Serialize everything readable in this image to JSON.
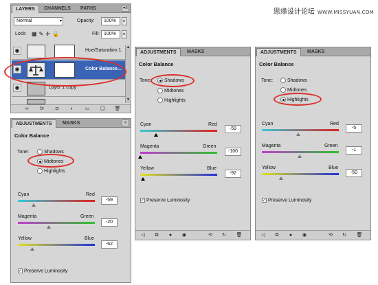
{
  "watermark": {
    "text": "思缘设计论坛",
    "site": "WWW.MISSYUAN.COM"
  },
  "layers_panel": {
    "tabs": [
      "LAYERS",
      "CHANNELS",
      "PATHS"
    ],
    "blend_mode": "Normal",
    "opacity_label": "Opacity:",
    "opacity_value": "100%",
    "lock_label": "Lock:",
    "fill_label": "Fill:",
    "fill_value": "100%",
    "layers": [
      {
        "name": "Hue/Saturation 1",
        "selected": false
      },
      {
        "name": "Color Balance...",
        "selected": true
      },
      {
        "name": "Layer 1 copy",
        "selected": false
      }
    ],
    "bottom_icons": [
      "link-icon",
      "fx-icon",
      "mask-icon",
      "adjustment-icon",
      "folder-icon",
      "new-layer-icon",
      "trash-icon"
    ]
  },
  "adjustments_panels": [
    {
      "tabs": [
        "ADJUSTMENTS",
        "MASKS"
      ],
      "title": "Color Balance",
      "tone_label": "Tone:",
      "tones": [
        "Shadows",
        "Midtones",
        "Highlights"
      ],
      "selected_tone": "Midtones",
      "sliders": [
        {
          "left": "Cyan",
          "right": "Red",
          "value": "-59",
          "level": -59
        },
        {
          "left": "Magenta",
          "right": "Green",
          "value": "-20",
          "level": -20
        },
        {
          "left": "Yellow",
          "right": "Blue",
          "value": "-62",
          "level": -62
        }
      ],
      "preserve_label": "Preserve Luminosity",
      "preserve_checked": true
    },
    {
      "tabs": [
        "ADJUSTMENTS",
        "MASKS"
      ],
      "title": "Color Balance",
      "tone_label": "Tone:",
      "tones": [
        "Shadows",
        "Midtones",
        "Highlights"
      ],
      "selected_tone": "Shadows",
      "sliders": [
        {
          "left": "Cyan",
          "right": "Red",
          "value": "-59",
          "level": -59
        },
        {
          "left": "Magenta",
          "right": "Green",
          "value": "-100",
          "level": -100
        },
        {
          "left": "Yellow",
          "right": "Blue",
          "value": "-92",
          "level": -92
        }
      ],
      "preserve_label": "Preserve Luminosity",
      "preserve_checked": true
    },
    {
      "tabs": [
        "ADJUSTMENTS",
        "MASKS"
      ],
      "title": "Color Balance",
      "tone_label": "Tone:",
      "tones": [
        "Shadows",
        "Midtones",
        "Highlights"
      ],
      "selected_tone": "Highlights",
      "sliders": [
        {
          "left": "Cyan",
          "right": "Red",
          "value": "-5",
          "level": -5
        },
        {
          "left": "Magenta",
          "right": "Green",
          "value": "-1",
          "level": -1
        },
        {
          "left": "Yellow",
          "right": "Blue",
          "value": "-50",
          "level": -50
        }
      ],
      "preserve_label": "Preserve Luminosity",
      "preserve_checked": true
    }
  ],
  "colors": {
    "highlight_circle": "#d9302a",
    "selected_layer": "#3a63b6"
  }
}
